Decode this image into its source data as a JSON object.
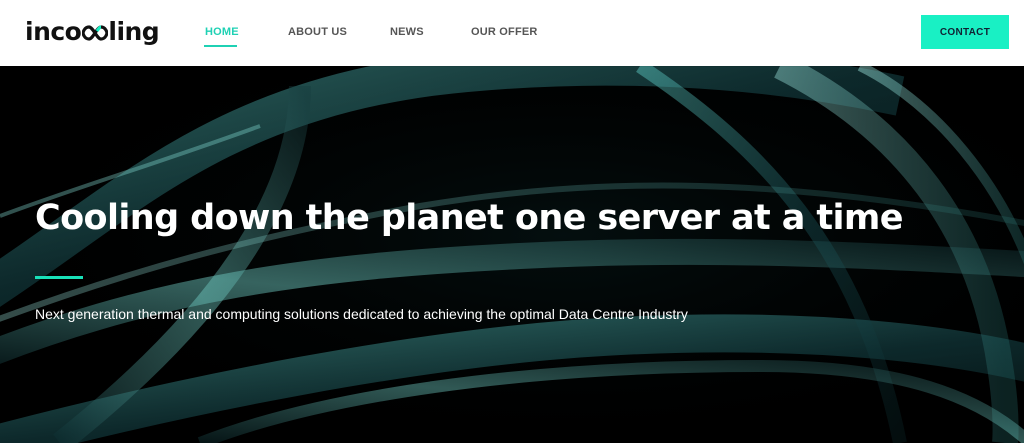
{
  "brand": {
    "logo_left": "inco",
    "logo_right": "ling",
    "accent_color": "#19f0c4",
    "mark_icon": "infinity-loop-icon"
  },
  "nav": {
    "items": [
      {
        "label": "HOME",
        "active": true
      },
      {
        "label": "ABOUT US",
        "active": false
      },
      {
        "label": "NEWS",
        "active": false
      },
      {
        "label": "OUR OFFER",
        "active": false
      }
    ],
    "contact_label": "CONTACT"
  },
  "hero": {
    "title": "Cooling down the planet one server at a time",
    "subtitle": "Next generation thermal and computing solutions dedicated to achieving the optimal Data Centre Industry",
    "background_color": "#000000"
  }
}
